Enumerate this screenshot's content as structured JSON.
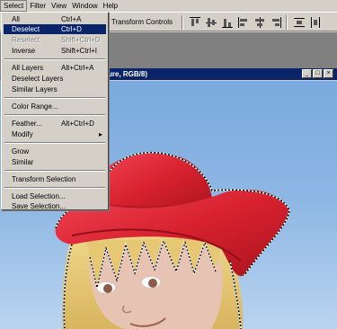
{
  "menubar": {
    "items": [
      {
        "label": "Select",
        "active": true
      },
      {
        "label": "Filter"
      },
      {
        "label": "View"
      },
      {
        "label": "Window"
      },
      {
        "label": "Help"
      }
    ]
  },
  "options_bar": {
    "transform_label": "w Transform Controls"
  },
  "document": {
    "title": "ure, RGB/8)"
  },
  "select_menu": {
    "items": [
      {
        "label": "All",
        "shortcut": "Ctrl+A"
      },
      {
        "label": "Deselect",
        "shortcut": "Ctrl+D",
        "highlighted": true
      },
      {
        "label": "Reselect",
        "shortcut": "Shift+Ctrl+D",
        "disabled": true
      },
      {
        "label": "Inverse",
        "shortcut": "Shift+Ctrl+I"
      },
      {
        "label": "All Layers",
        "shortcut": "Alt+Ctrl+A"
      },
      {
        "label": "Deselect Layers",
        "shortcut": ""
      },
      {
        "label": "Similar Layers",
        "shortcut": ""
      },
      {
        "label": "Color Range...",
        "shortcut": ""
      },
      {
        "label": "Feather...",
        "shortcut": "Alt+Ctrl+D"
      },
      {
        "label": "Modify",
        "shortcut": "",
        "submenu": true
      },
      {
        "label": "Grow",
        "shortcut": ""
      },
      {
        "label": "Similar",
        "shortcut": ""
      },
      {
        "label": "Transform Selection",
        "shortcut": ""
      },
      {
        "label": "Load Selection...",
        "shortcut": ""
      },
      {
        "label": "Save Selection...",
        "shortcut": ""
      }
    ]
  },
  "colors": {
    "highlight": "#0a246a",
    "menu_bg": "#d4d0c8",
    "hat_red": "#d8212f",
    "sky_blue": "#6e9fd8",
    "hair_yellow": "#e9cf7c",
    "skin": "#e7c3b4"
  },
  "icons": [
    "align-left-icon",
    "align-center-icon",
    "align-right-icon",
    "align-top-icon",
    "align-middle-icon",
    "align-bottom-icon",
    "distribute-icon"
  ]
}
